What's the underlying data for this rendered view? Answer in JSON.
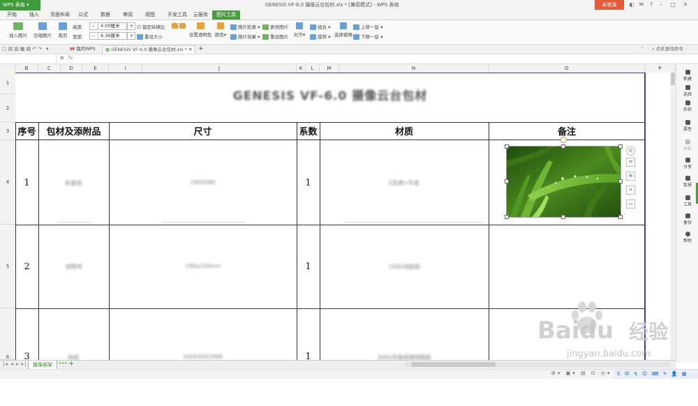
{
  "app": {
    "name": "WPS 表格",
    "window_title": "GENESIS VF-6.0 摄像云台包材.xls * [兼容模式] - WPS 表格",
    "login_label": "未登录"
  },
  "ribbon_tabs": [
    "开始",
    "插入",
    "页面布局",
    "公式",
    "数据",
    "审阅",
    "视图",
    "开发工具",
    "云服务",
    "图片工具"
  ],
  "active_tab": "图片工具",
  "ribbon": {
    "insert_picture": "插入图片",
    "compress_picture": "压缩图片",
    "crop": "裁剪",
    "height_label": "高度:",
    "height_value": "4.00厘米",
    "width_label": "宽度:",
    "width_value": "6.36厘米",
    "lock_ratio": "锁定纵横比",
    "reset_size": "重设大小",
    "set_transparent": "设置透明色",
    "color": "颜色",
    "picture_outline": "图片轮廓",
    "picture_effect": "图片效果",
    "change_picture": "更改图片",
    "reset_picture": "重设图片",
    "align": "对齐",
    "group": "组合",
    "rotate": "旋转",
    "selection_pane": "选择窗格",
    "bring_forward": "上移一层",
    "send_backward": "下移一层"
  },
  "quickbar": {
    "my_wps": "我的WPS",
    "doc_tab": "GENESIS VF-6.0 摄像云台包材.xls *",
    "search_hint": "点此查找命令"
  },
  "formula_bar": {
    "fx": "fx"
  },
  "columns": [
    "B",
    "C",
    "D",
    "E",
    "I",
    "J",
    "K",
    "L",
    "M",
    "N",
    "O",
    "P"
  ],
  "rows": [
    "1",
    "2",
    "3",
    "4",
    "5",
    "6"
  ],
  "sheet": {
    "title": "GENESIS VF-6.0 摄像云台包材",
    "headers": [
      "序号",
      "包材及添附品",
      "尺寸",
      "系数",
      "材质",
      "备注"
    ],
    "data_rows": [
      {
        "no": "1",
        "name": "彩盒泡",
        "size": "195X560",
        "factor": "1",
        "material": "E瓦楞+牛皮"
      },
      {
        "no": "2",
        "name": "说明书",
        "size": "190x210mm",
        "factor": "1",
        "material": "105G双胶纸"
      },
      {
        "no": "3",
        "name": "贴纸",
        "size": "165X30X3300",
        "factor": "1",
        "material": "300G灰板纸裱铜版纸"
      }
    ]
  },
  "side_panel": [
    "新建",
    "选择",
    "形状",
    "属性",
    "分析",
    "分享",
    "智慧",
    "工具",
    "备份",
    "帮助"
  ],
  "sheet_tab": "摄像部架",
  "watermark": {
    "brand": "Baidu",
    "brand_cn": "经验",
    "url": "jingyan.baidu.com"
  },
  "colors": {
    "accent": "#4d9b42",
    "login": "#e35a3d",
    "selection_border": "#3c3cb4"
  }
}
